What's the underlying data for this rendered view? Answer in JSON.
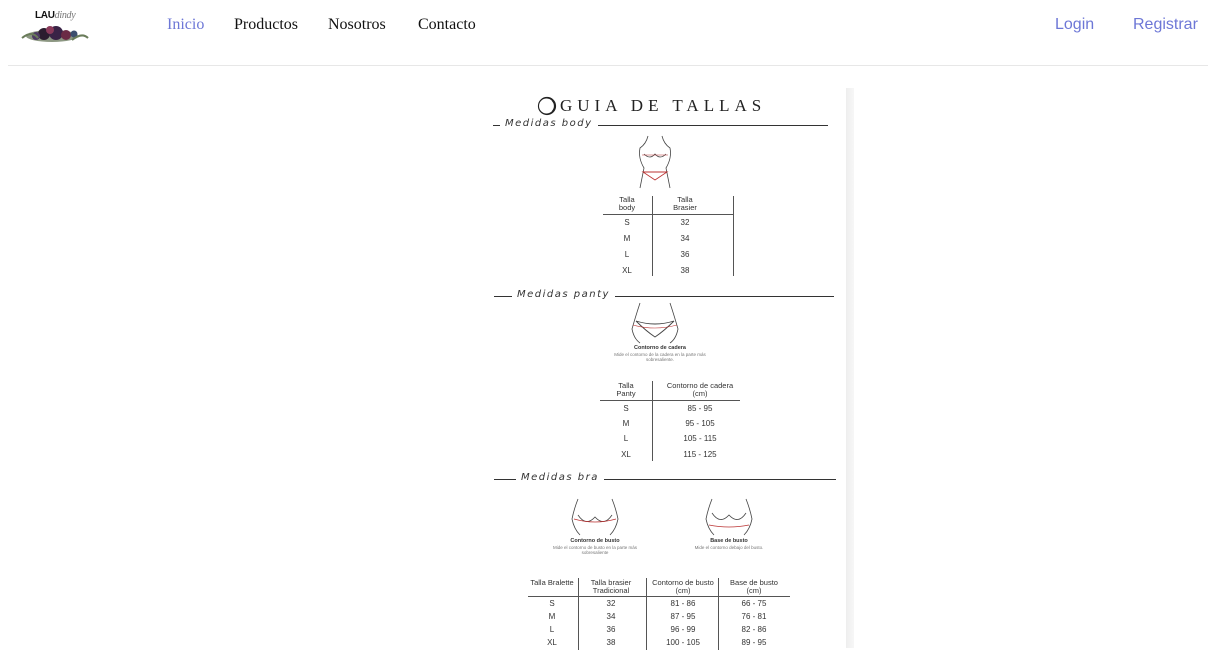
{
  "brand": {
    "name": "LAU",
    "tagline": "dindy"
  },
  "nav": {
    "links": [
      {
        "label": "Inicio",
        "active": true
      },
      {
        "label": "Productos",
        "active": false
      },
      {
        "label": "Nosotros",
        "active": false
      },
      {
        "label": "Contacto",
        "active": false
      }
    ],
    "login": "Login",
    "register": "Registrar"
  },
  "size_guide": {
    "title": "GUIA DE TALLAS",
    "body": {
      "section": "Medidas body",
      "headers": [
        "Talla body",
        "Talla Brasier"
      ],
      "rows": [
        [
          "S",
          "32"
        ],
        [
          "M",
          "34"
        ],
        [
          "L",
          "36"
        ],
        [
          "XL",
          "38"
        ]
      ]
    },
    "panty": {
      "section": "Medidas panty",
      "caption": "Contorno de cadera",
      "caption_sub": "Mide el contorno de la cadera en la parte más sobresaliente.",
      "headers": [
        "Talla Panty",
        "Contorno de cadera (cm)"
      ],
      "rows": [
        [
          "S",
          "85 - 95"
        ],
        [
          "M",
          "95 - 105"
        ],
        [
          "L",
          "105 - 115"
        ],
        [
          "XL",
          "115 - 125"
        ]
      ]
    },
    "bra": {
      "section": "Medidas bra",
      "caption_left": "Contorno de busto",
      "caption_left_sub": "Mide el contorno de busto en la parte más sobresaliente",
      "caption_right": "Base de busto",
      "caption_right_sub": "Mide el contorno debajo del busto.",
      "headers": [
        "Talla Bralette",
        "Talla brasier Tradicional",
        "Contorno de busto (cm)",
        "Base de busto (cm)"
      ],
      "rows": [
        [
          "S",
          "32",
          "81 - 86",
          "66 - 75"
        ],
        [
          "M",
          "34",
          "87 - 95",
          "76 - 81"
        ],
        [
          "L",
          "36",
          "96 - 99",
          "82 - 86"
        ],
        [
          "XL",
          "38",
          "100 - 105",
          "89 - 95"
        ]
      ]
    }
  },
  "colors": {
    "accent": "#6d77d6",
    "text": "#222222",
    "divider": "#e7e7e7"
  }
}
